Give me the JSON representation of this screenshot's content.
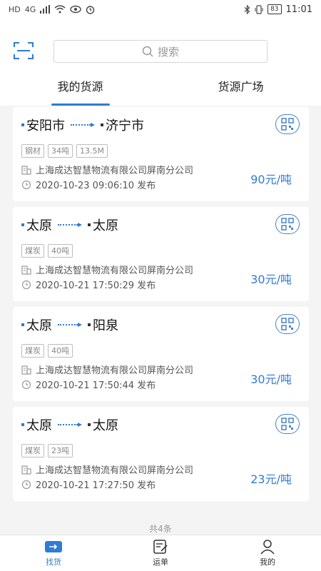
{
  "status_bar": {
    "left_icons": [
      "HD",
      "4G",
      "signal",
      "wifi",
      "eye",
      "alarm"
    ],
    "battery": "83",
    "time": "11:01"
  },
  "search": {
    "placeholder": "搜索",
    "icon": "search-icon"
  },
  "tabs": [
    {
      "label": "我的货源",
      "active": true
    },
    {
      "label": "货源广场",
      "active": false
    }
  ],
  "cards": [
    {
      "from": "安阳市",
      "to": "济宁市",
      "tags": [
        "钢材",
        "34吨",
        "13.5M"
      ],
      "company": "上海成达智慧物流有限公司屏南分公司",
      "time": "2020-10-23 09:06:10 发布",
      "price": "90元/吨"
    },
    {
      "from": "太原",
      "to": "太原",
      "tags": [
        "煤炭",
        "40吨"
      ],
      "company": "上海成达智慧物流有限公司屏南分公司",
      "time": "2020-10-21 17:50:29 发布",
      "price": "30元/吨"
    },
    {
      "from": "太原",
      "to": "阳泉",
      "tags": [
        "煤炭",
        "40吨"
      ],
      "company": "上海成达智慧物流有限公司屏南分公司",
      "time": "2020-10-21 17:50:44 发布",
      "price": "30元/吨"
    },
    {
      "from": "太原",
      "to": "太原",
      "tags": [
        "煤炭",
        "23吨"
      ],
      "company": "上海成达智慧物流有限公司屏南分公司",
      "time": "2020-10-21 17:27:50 发布",
      "price": "23元/吨"
    }
  ],
  "total": "共4条",
  "bottom_nav": [
    {
      "label": "找货",
      "icon": "truck-icon",
      "active": true
    },
    {
      "label": "运单",
      "icon": "waybill-icon",
      "active": false
    },
    {
      "label": "我的",
      "icon": "user-icon",
      "active": false
    }
  ],
  "colors": {
    "accent": "#2f7bd6",
    "background": "#f4f4f4"
  }
}
